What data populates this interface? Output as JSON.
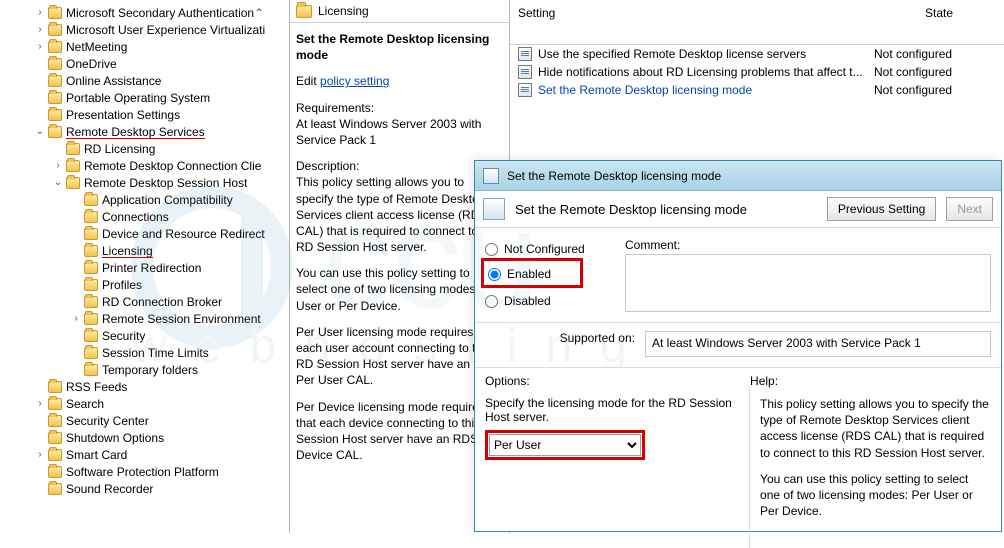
{
  "tree": {
    "items": [
      {
        "label": "Microsoft Secondary Authentication",
        "indent": 1,
        "toggle": ">",
        "marker": "caret"
      },
      {
        "label": "Microsoft User Experience Virtualizati",
        "indent": 1,
        "toggle": ">"
      },
      {
        "label": "NetMeeting",
        "indent": 1,
        "toggle": ">"
      },
      {
        "label": "OneDrive",
        "indent": 1,
        "toggle": ""
      },
      {
        "label": "Online Assistance",
        "indent": 1,
        "toggle": ""
      },
      {
        "label": "Portable Operating System",
        "indent": 1,
        "toggle": ""
      },
      {
        "label": "Presentation Settings",
        "indent": 1,
        "toggle": ""
      },
      {
        "label": "Remote Desktop Services",
        "indent": 1,
        "toggle": "v",
        "highlight": true
      },
      {
        "label": "RD Licensing",
        "indent": 2,
        "toggle": ""
      },
      {
        "label": "Remote Desktop Connection Clie",
        "indent": 2,
        "toggle": ">"
      },
      {
        "label": "Remote Desktop Session Host",
        "indent": 2,
        "toggle": "v"
      },
      {
        "label": "Application Compatibility",
        "indent": 3,
        "toggle": ""
      },
      {
        "label": "Connections",
        "indent": 3,
        "toggle": ""
      },
      {
        "label": "Device and Resource Redirect",
        "indent": 3,
        "toggle": ""
      },
      {
        "label": "Licensing",
        "indent": 3,
        "toggle": "",
        "highlight": true
      },
      {
        "label": "Printer Redirection",
        "indent": 3,
        "toggle": ""
      },
      {
        "label": "Profiles",
        "indent": 3,
        "toggle": ""
      },
      {
        "label": "RD Connection Broker",
        "indent": 3,
        "toggle": ""
      },
      {
        "label": "Remote Session Environment",
        "indent": 3,
        "toggle": ">"
      },
      {
        "label": "Security",
        "indent": 3,
        "toggle": ""
      },
      {
        "label": "Session Time Limits",
        "indent": 3,
        "toggle": ""
      },
      {
        "label": "Temporary folders",
        "indent": 3,
        "toggle": ""
      },
      {
        "label": "RSS Feeds",
        "indent": 1,
        "toggle": ""
      },
      {
        "label": "Search",
        "indent": 1,
        "toggle": ">"
      },
      {
        "label": "Security Center",
        "indent": 1,
        "toggle": ""
      },
      {
        "label": "Shutdown Options",
        "indent": 1,
        "toggle": ""
      },
      {
        "label": "Smart Card",
        "indent": 1,
        "toggle": ">"
      },
      {
        "label": "Software Protection Platform",
        "indent": 1,
        "toggle": ""
      },
      {
        "label": "Sound Recorder",
        "indent": 1,
        "toggle": ""
      }
    ]
  },
  "mid": {
    "header": "Licensing",
    "title": "Set the Remote Desktop licensing mode",
    "edit_prefix": "Edit ",
    "edit_link": "policy setting",
    "req_h": "Requirements:",
    "req": "At least Windows Server 2003 with Service Pack 1",
    "desc_h": "Description:",
    "desc1": "This policy setting allows you to specify the type of Remote Desktop Services client access license (RDS CAL) that is required to connect to this RD Session Host server.",
    "desc2": "You can use this policy setting to select one of two licensing modes: Per User or Per Device.",
    "desc3": "Per User licensing mode requires that each user account connecting to this RD Session Host server have an RDS Per User CAL.",
    "desc4": "Per Device licensing mode requires that each device connecting to this RD Session Host server have an RDS Per Device CAL."
  },
  "list": {
    "col_setting": "Setting",
    "col_state": "State",
    "rows": [
      {
        "label": "Use the specified Remote Desktop license servers",
        "state": "Not configured"
      },
      {
        "label": "Hide notifications about RD Licensing problems that affect t...",
        "state": "Not configured"
      },
      {
        "label": "Set the Remote Desktop licensing mode",
        "state": "Not configured",
        "selected": true
      }
    ]
  },
  "dialog": {
    "win_title": "Set the Remote Desktop licensing mode",
    "inner_title": "Set the Remote Desktop licensing mode",
    "btn_prev": "Previous Setting",
    "btn_next": "Next",
    "radio_not": "Not Configured",
    "radio_en": "Enabled",
    "radio_dis": "Disabled",
    "comment_lbl": "Comment:",
    "supported_lbl": "Supported on:",
    "supported_val": "At least Windows Server 2003 with Service Pack 1",
    "options_lbl": "Options:",
    "help_lbl": "Help:",
    "spec_label": "Specify the licensing mode for the RD Session Host server.",
    "dropdown_value": "Per User",
    "help1": "This policy setting allows you to specify the type of Remote Desktop Services client access license (RDS CAL) that is required to connect to this RD Session Host server.",
    "help2": "You can use this policy setting to select one of two licensing modes: Per User or Per Device."
  }
}
